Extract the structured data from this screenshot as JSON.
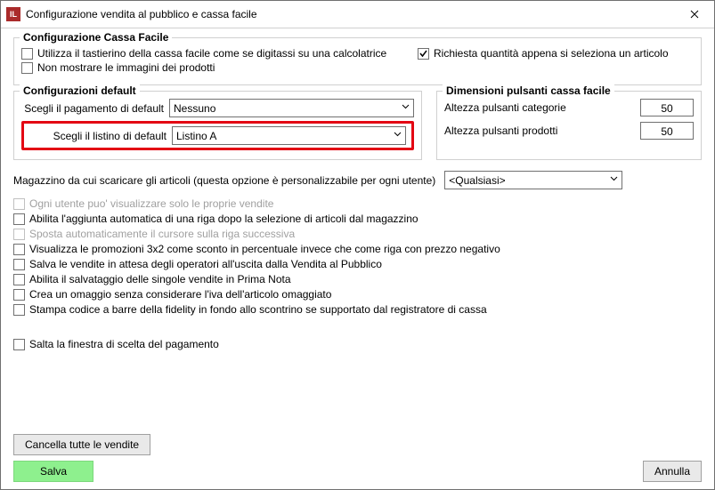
{
  "title": "Configurazione vendita al pubblico e cassa facile",
  "group_cassa": {
    "title": "Configurazione Cassa Facile",
    "opt_tastierino": "Utilizza il tastierino della cassa facile come se digitassi su una calcolatrice",
    "opt_no_immagini": "Non mostrare le immagini dei prodotti",
    "opt_richiesta_qta": "Richiesta quantità appena si seleziona un articolo"
  },
  "group_default": {
    "title": "Configurazioni default",
    "label_pagamento": "Scegli il pagamento di default",
    "value_pagamento": "Nessuno",
    "label_listino": "Scegli il listino di default",
    "value_listino": "Listino A"
  },
  "group_dim": {
    "title": "Dimensioni pulsanti cassa facile",
    "label_categorie": "Altezza pulsanti categorie",
    "val_categorie": "50",
    "label_prodotti": "Altezza pulsanti prodotti",
    "val_prodotti": "50"
  },
  "magazzino": {
    "label": "Magazzino da cui scaricare gli articoli (questa opzione è personalizzabile per ogni utente)",
    "value": "<Qualsiasi>"
  },
  "opts": {
    "own_sales": "Ogni utente puo' visualizzare solo le proprie vendite",
    "auto_row": "Abilita l'aggiunta automatica di una riga dopo la selezione di articoli dal magazzino",
    "auto_cursor": "Sposta automaticamente il cursore sulla riga successiva",
    "promo3x2": "Visualizza le promozioni 3x2 come sconto in percentuale invece che come riga con prezzo negativo",
    "save_pending": "Salva le vendite in attesa degli operatori all'uscita dalla Vendita al Pubblico",
    "prima_nota": "Abilita il salvataggio delle singole vendite in Prima Nota",
    "omaggio": "Crea un omaggio senza considerare l'iva dell'articolo omaggiato",
    "barcode": "Stampa codice a barre della fidelity in fondo allo scontrino se supportato dal registratore di cassa",
    "skip_payment_window": "Salta la finestra di scelta del pagamento"
  },
  "buttons": {
    "cancel_all": "Cancella tutte le vendite",
    "save": "Salva",
    "cancel": "Annulla"
  }
}
